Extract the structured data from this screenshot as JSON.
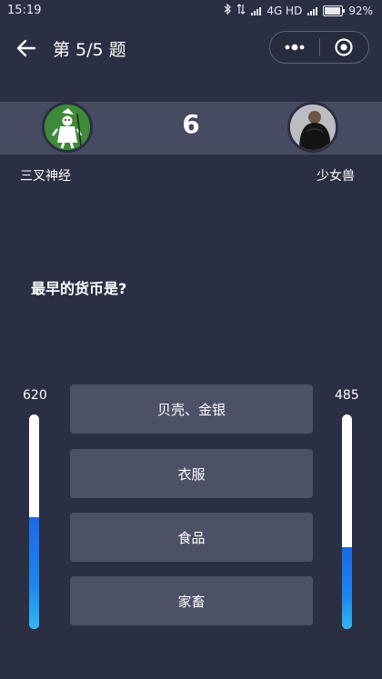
{
  "status_bar": {
    "time": "15:19",
    "network": "4G HD",
    "battery": "92%",
    "battery_level": 0.92
  },
  "nav": {
    "title": "第 5/5 题",
    "icons": [
      "back-arrow-icon",
      "more-dots-icon",
      "close-target-icon"
    ]
  },
  "battle": {
    "round_number": "6",
    "left_player": {
      "name": "三叉神经",
      "score": "620",
      "energy": 0.52
    },
    "right_player": {
      "name": "少女兽",
      "score": "485",
      "energy": 0.38
    }
  },
  "question": {
    "text": "最早的货币是?",
    "options": [
      "贝壳、金银",
      "衣服",
      "食品",
      "家畜"
    ]
  },
  "colors": {
    "background": "#2b2f44",
    "band": "#464b61",
    "option": "#4d5166",
    "bar_fill": "#1e86ec"
  }
}
